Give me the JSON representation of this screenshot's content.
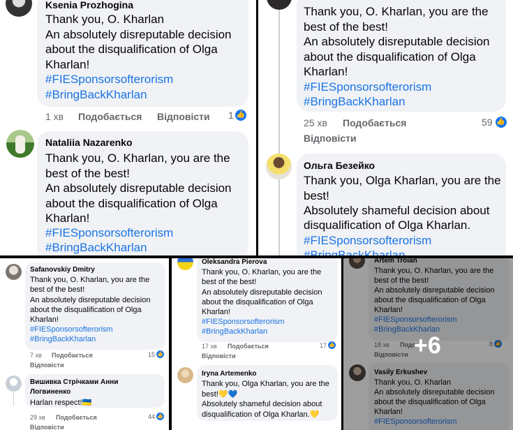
{
  "top_left": {
    "c1": {
      "name": "Ksenia Prozhogina",
      "lines": [
        "Thank you, O. Kharlan",
        "An absolutely disreputable decision",
        "about the disqualification of Olga",
        "Kharlan!"
      ],
      "tags": [
        "#FIESponsorsofterorism",
        "#BringBackKharlan"
      ],
      "time": "1 хв",
      "like": "Подобається",
      "reply": "Відповісти",
      "count": "1"
    },
    "c2": {
      "name": "Nataliia Nazarenko",
      "lines": [
        "Thank you, O. Kharlan, you are the",
        "best of the best!",
        "An absolutely disreputable decision",
        "about the disqualification of Olga",
        "Kharlan!"
      ],
      "tags": [
        "#FIESponsorsofterorism",
        "#BringBackKharlan"
      ]
    }
  },
  "top_right": {
    "c1": {
      "lines": [
        "Thank you, O. Kharlan, you are the",
        "best of the best!",
        "An absolutely disreputable decision",
        "about the disqualification of Olga",
        "Kharlan!"
      ],
      "tags": [
        "#FIESponsorsofterorism",
        "#BringBackKharlan"
      ],
      "time": "25 хв",
      "like": "Подобається",
      "reply": "Відповісти",
      "count": "59"
    },
    "c2": {
      "name": "Ольга Безейко",
      "lines": [
        "Thank you, Olga Kharlan, you are the",
        "best!",
        "Absolutely shameful decision about",
        "disqualification of Olga Kharlan."
      ],
      "tags": [
        "#FIESponsorsofterorism",
        "#BringBackKharlan"
      ]
    }
  },
  "bottom_left": {
    "c1": {
      "name": "Safanovskiy Dmitry",
      "lines": [
        "Thank you, O. Kharlan, you are the",
        "best of the best!",
        "An absolutely disreputable decision",
        "about the disqualification of Olga",
        "Kharlan!"
      ],
      "tags": [
        "#FIESponsorsofterorism",
        "#BringBackKharlan"
      ],
      "time": "7 хв",
      "like": "Подобається",
      "reply": "Відповісти",
      "count": "15"
    },
    "c2": {
      "name_line1": "Вишивка Стрічками Анни",
      "name_line2": "Логвиненко",
      "lines": [
        "Harlan respect!🇺🇦"
      ],
      "time": "29 хв",
      "like": "Подобається",
      "reply": "Відповісти",
      "count": "44"
    }
  },
  "bottom_middle": {
    "c1": {
      "name": "Oleksandra Pierova",
      "lines": [
        "Thank you, O. Kharlan, you are the",
        "best of the best!",
        "An absolutely disreputable decision",
        "about the disqualification of Olga",
        "Kharlan!"
      ],
      "tags": [
        "#FIESponsorsofterorism",
        "#BringBackKharlan"
      ],
      "time": "17 хв",
      "like": "Подобається",
      "reply": "Відповісти",
      "count": "17"
    },
    "c2": {
      "name": "Iryna Artemenko",
      "lines": [
        "Thank you, Olga Kharlan, you are the",
        "best!💛💙",
        "Absolutely shameful decision about",
        "disqualification of Olga Kharlan.💛"
      ]
    }
  },
  "bottom_right": {
    "c1": {
      "name": "Artem Troian",
      "lines": [
        "Thank you, O. Kharlan, you are the",
        "best of the best!",
        "An absolutely disreputable decision",
        "about the disqualification of Olga",
        "Kharlan!"
      ],
      "tags": [
        "#FIESponsorsofterorism",
        "#BringBackKharlan"
      ],
      "time": "18 хв",
      "like": "Подо",
      "reply": "Відповісти",
      "count": "8"
    },
    "c2": {
      "name": "Vasily Erkushev",
      "lines": [
        "Thank you, O. Kharlan",
        "An absolutely disreputable decision",
        "about the disqualification of Olga",
        "Kharlan!"
      ],
      "tags": [
        "#FIESponsorsofterorism"
      ]
    },
    "more_overlay": "+6"
  },
  "colors": {
    "link": "#1b74e4",
    "bubble": "#f0f2f5",
    "like": "#1877f2"
  },
  "icons": {
    "like": "thumbs-up-icon"
  }
}
